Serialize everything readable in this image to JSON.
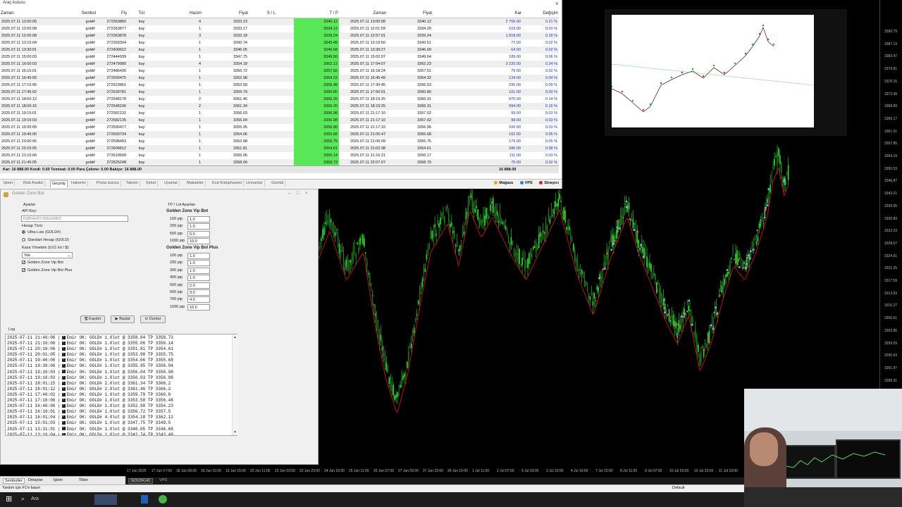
{
  "terminal": {
    "title": "Araç kutusu",
    "columns": [
      "Zaman",
      "Sembol",
      "Fiş",
      "Tür",
      "Hacim",
      "Fiyat",
      "S / L",
      "T / P",
      "Zaman",
      "Fiyat",
      "Kar",
      "Değişim"
    ],
    "rows": [
      [
        "2025.07.11 12:00:05",
        "gold#",
        "272363860",
        "buy",
        "4",
        "3333.23",
        "",
        "3340.12",
        "2025.07.11 13:00:08",
        "3340.12",
        "2 756.00",
        "0.21 %"
      ],
      [
        "2025.07.11 12:00:08",
        "gold#",
        "272363877",
        "buy",
        "1",
        "3333.17",
        "",
        "3334.12",
        "2025.07.11 12:01:59",
        "3334.20",
        "103.00",
        "0.03 %"
      ],
      [
        "2025.07.11 12:00:08",
        "gold#",
        "272363878",
        "buy",
        "3",
        "3333.18",
        "",
        "3339.24",
        "2025.07.11 12:57:01",
        "3339.24",
        "1 818.00",
        "0.18 %"
      ],
      [
        "2025.07.11 13:15:04",
        "gold#",
        "272393304",
        "buy",
        "1",
        "3342.74",
        "",
        "3343.49",
        "2025.07.11 13:16:50",
        "3343.51",
        "77.00",
        "0.02 %"
      ],
      [
        "2025.07.11 13:30:01",
        "gold#",
        "272400622",
        "buy",
        "1",
        "3346.05",
        "",
        "3346.68",
        "2025.07.11 13:39:27",
        "3346.69",
        "64.00",
        "0.02 %"
      ],
      [
        "2025.07.11 15:00:03",
        "gold#",
        "272444939",
        "buy",
        "1",
        "3347.75",
        "",
        "3349.50",
        "2025.07.11 15:02:07",
        "3349.64",
        "189.00",
        "0.06 %"
      ],
      [
        "2025.07.11 16:00:03",
        "gold#",
        "272479980",
        "buy",
        "4",
        "3354.18",
        "",
        "3362.12",
        "2025.07.11 17:54:07",
        "3362.23",
        "3 220.00",
        "0.24 %"
      ],
      [
        "2025.07.11 16:15:01",
        "gold#",
        "272486435",
        "buy",
        "1",
        "3356.72",
        "",
        "3357.50",
        "2025.07.11 16:18:24",
        "3357.51",
        "79.00",
        "0.02 %"
      ],
      [
        "2025.07.11 16:45:05",
        "gold#",
        "272509475",
        "buy",
        "1",
        "3352.98",
        "",
        "3354.23",
        "2025.07.11 16:45:49",
        "3354.32",
        "134.00",
        "0.04 %"
      ],
      [
        "2025.07.11 17:15:06",
        "gold#",
        "272523861",
        "buy",
        "1",
        "3353.58",
        "",
        "3356.48",
        "2025.07.11 17:30:45",
        "3356.53",
        "295.00",
        "0.09 %"
      ],
      [
        "2025.07.11 17:45:02",
        "gold#",
        "272539781",
        "buy",
        "1",
        "3359.79",
        "",
        "3360.80",
        "2025.07.11 17:50:01",
        "3360.80",
        "101.00",
        "0.03 %"
      ],
      [
        "2025.07.11 18:00:12",
        "gold#",
        "272548178",
        "buy",
        "2",
        "3361.46",
        "",
        "3366.20",
        "2025.07.11 18:19:25",
        "3366.31",
        "970.00",
        "0.14 %"
      ],
      [
        "2025.07.11 18:00:15",
        "gold#",
        "272548196",
        "buy",
        "2",
        "3361.34",
        "",
        "3366.20",
        "2025.07.11 18:19:25",
        "3366.31",
        "994.00",
        "0.15 %"
      ],
      [
        "2025.07.11 19:15:01",
        "gold#",
        "272582132",
        "buy",
        "1",
        "3356.03",
        "",
        "3356.98",
        "2025.07.11 21:17:10",
        "3357.02",
        "99.00",
        "0.03 %"
      ],
      [
        "2025.07.11 19:15:03",
        "gold#",
        "272582135",
        "buy",
        "1",
        "3356.04",
        "",
        "3356.98",
        "2025.07.11 21:17:10",
        "3357.02",
        "98.00",
        "0.03 %"
      ],
      [
        "2025.07.11 19:35:05",
        "gold#",
        "272590477",
        "buy",
        "1",
        "3355.95",
        "",
        "3356.90",
        "2025.07.11 21:17:10",
        "3356.95",
        "100.00",
        "0.03 %"
      ],
      [
        "2025.07.11 19:46:06",
        "gold#",
        "272593734",
        "buy",
        "1",
        "3354.06",
        "",
        "3355.68",
        "2025.07.11 21:05:47",
        "3355.68",
        "162.00",
        "0.05 %"
      ],
      [
        "2025.07.11 20:00:05",
        "gold#",
        "272598493",
        "buy",
        "1",
        "3353.98",
        "",
        "3355.75",
        "2025.07.11 21:06:09",
        "3355.75",
        "179.00",
        "0.05 %"
      ],
      [
        "2025.07.11 20:15:05",
        "gold#",
        "272604812",
        "buy",
        "1",
        "3351.81",
        "",
        "3354.61",
        "2025.07.11 21:02:38",
        "3354.61",
        "280.00",
        "0.08 %"
      ],
      [
        "2025.07.11 21:15:06",
        "gold#",
        "272619509",
        "buy",
        "1",
        "3355.06",
        "",
        "3356.14",
        "2025.07.11 21:16:21",
        "3356.17",
        "111.00",
        "0.03 %"
      ],
      [
        "2025.07.11 21:45:05",
        "gold#",
        "272625248",
        "buy",
        "1",
        "3358.04",
        "",
        "3358.73",
        "2025.07.11 22:07:07",
        "3358.79",
        "75.00",
        "0.02 %"
      ]
    ],
    "summary": "Kar: 16 888.00  Kredi: 0.00  Teminat: 0.00  Para Çekme: 0.00  Bakiye: 16 888.00",
    "summary_total": "16 888.00",
    "tabs": [
      "İşlem",
      "Risk Analizi",
      "Geçmiş",
      "Haberler",
      "Posta kutusu",
      "Takvim",
      "Şirket",
      "Uyarılar",
      "Makaleler",
      "Kod Kütüphanesi",
      "Uzmanlar",
      "Günlük"
    ],
    "active_tab": "Geçmiş",
    "status_items": [
      "Mağaza",
      "VPS",
      "Sinayıcı"
    ]
  },
  "bot": {
    "title": "Golden Zone Bot",
    "settings_label": "Ayarlar",
    "api_key_label": "API Key:",
    "api_key_value": "Kd8h4cK0 9Gk2eRbS",
    "account_type_label": "Hesap Türü:",
    "account_options": [
      "Ultra Low (GOLD#)",
      "Standart Hesap (GOLD)"
    ],
    "selected_account": 0,
    "cash_mgmt_label": "Kasa Yönetimi (0.01 lot / $):",
    "cash_mgmt_value": "Yok",
    "checkboxes": [
      "Golden Zone Vip Bot",
      "Golden Zone Vip Bot Plus"
    ],
    "tp_section_label": "TP / Lot Ayarları",
    "vip_title": "Golden Zone Vip Bot",
    "vip_rows": [
      [
        "100 pip",
        "1.0"
      ],
      [
        "200 pip",
        "1.0"
      ],
      [
        "500 pip",
        "5.0"
      ],
      [
        "1000 pip",
        "10.0"
      ]
    ],
    "plus_title": "Golden Zone Vip Bot Plus",
    "plus_rows": [
      [
        "100 pip",
        "1.0"
      ],
      [
        "200 pip",
        "1.0"
      ],
      [
        "300 pip",
        "1.0"
      ],
      [
        "400 pip",
        "1.0"
      ],
      [
        "500 pip",
        "2.0"
      ],
      [
        "600 pip",
        "3.0"
      ],
      [
        "700 pip",
        "4.0"
      ],
      [
        "1000 pip",
        "10.0"
      ]
    ],
    "buttons": {
      "save": "Kaydet",
      "start": "Başlat",
      "stop": "Durdur"
    },
    "log_label": "Log",
    "log_lines": [
      "2025-07-11 21:46:06 |  Emir OK: GOLD# 1.0lot @ 3358.04 TP 3358.73",
      "2025-07-11 21:16:06 |  Emir OK: GOLD# 1.0lot @ 3355.06 TP 3356.14",
      "2025-07-11 20:16:06 |  Emir OK: GOLD# 1.0lot @ 3351.81 TP 3354.61",
      "2025-07-11 20:01:05 |  Emir OK: GOLD# 1.0lot @ 3353.98 TP 3355.75",
      "2025-07-11 19:46:06 |  Emir OK: GOLD# 1.0lot @ 3354.06 TP 3355.68",
      "2025-07-11 19:36:06 |  Emir OK: GOLD# 1.0lot @ 3355.95 TP 3356.94",
      "2025-07-11 19:16:03 |  Emir OK: GOLD# 1.0lot @ 3356.04 TP 3356.98",
      "2025-07-11 19:16:03 |  Emir OK: GOLD# 1.0lot @ 3356.03 TP 3356.98",
      "2025-07-11 18:01:15 |  Emir OK: GOLD# 2.0lot @ 3361.34 TP 3366.2",
      "2025-07-11 18:01:12 |  Emir OK: GOLD# 2.0lot @ 3361.46 TP 3366.2",
      "2025-07-11 17:46:02 |  Emir OK: GOLD# 1.0lot @ 3359.79 TP 3360.8",
      "2025-07-11 17:16:06 |  Emir OK: GOLD# 1.0lot @ 3353.58 TP 3356.48",
      "2025-07-11 16:46:06 |  Emir OK: GOLD# 1.0lot @ 3352.98 TP 3354.23",
      "2025-07-11 16:16:01 |  Emir OK: GOLD# 1.0lot @ 3356.72 TP 3357.5",
      "2025-07-11 16:01:04 |  Emir OK: GOLD# 4.0lot @ 3354.18 TP 3362.12",
      "2025-07-11 15:01:03 |  Emir OK: GOLD# 1.0lot @ 3347.75 TP 3349.5",
      "2025-07-11 13:31:01 |  Emir OK: GOLD# 1.0lot @ 3346.05 TP 3346.68",
      "2025-07-11 13:16:04 |  Emir OK: GOLD# 1.0lot @ 3342.74 TP 3343.49"
    ]
  },
  "chart": {
    "price_labels": [
      "3390.79",
      "3387.13",
      "3383.47",
      "3379.81",
      "3376.15",
      "3372.49",
      "3368.83",
      "3365.17",
      "3361.51",
      "3357.85",
      "3354.19",
      "3350.53",
      "3346.87",
      "3343.21",
      "3339.55",
      "3335.89",
      "3332.23",
      "3328.57",
      "3324.91",
      "3321.25",
      "3317.59",
      "3313.93",
      "3310.27",
      "3306.61",
      "3302.95",
      "3299.29",
      "3295.63",
      "3291.97",
      "3288.31",
      "3284.65",
      "3280.99"
    ],
    "time_labels": [
      "17 Jun 2025",
      "17 Jun 17:00",
      "18 Jun 09:00",
      "18 Jun 19:00",
      "19 Jun 15:00",
      "20 Jun 11:00",
      "23 Jun 03:00",
      "23 Jun 23:00",
      "24 Jun 15:00",
      "25 Jun 11:00",
      "26 Jun 07:00",
      "27 Jun 03:00",
      "27 Jun 23:00",
      "30 Jun 15:00",
      "1 Jul 11:00",
      "2 Jul 07:00",
      "3 Jul 03:00",
      "3 Jul 23:00",
      "4 Jul 19:00",
      "7 Jul 15:00",
      "8 Jul 11:00",
      "9 Jul 07:00",
      "10 Jul 03:00",
      "10 Jul 23:00",
      "11 Jul 19:00"
    ],
    "symbol_tab": "GOLD#,H1",
    "vps_tab": "VPS",
    "bull_color": "#38d838",
    "ma_color": "#b01818"
  },
  "left_bottom_tabs": [
    "Semboller",
    "Detaylar",
    "İşlem",
    "Tikler"
  ],
  "status_bar": {
    "help": "Yardım için F1'e basın",
    "profile": "Default"
  },
  "taskbar": {
    "search": "Ara"
  }
}
